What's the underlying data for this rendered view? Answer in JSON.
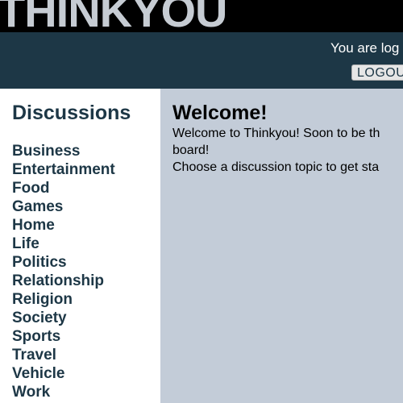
{
  "header": {
    "logo_text": "THINKYOU"
  },
  "account": {
    "status_text": "You are log",
    "logout_label": "LOGOU"
  },
  "sidebar": {
    "title": "Discussions",
    "topics": [
      "Business",
      "Entertainment",
      "Food",
      "Games",
      "Home",
      "Life",
      "Politics",
      "Relationship",
      "Religion",
      "Society",
      "Sports",
      "Travel",
      "Vehicle",
      "Work"
    ]
  },
  "main": {
    "title": "Welcome!",
    "lines": [
      "Welcome to Thinkyou! Soon to be th",
      "board!",
      "Choose a discussion topic to get sta"
    ]
  },
  "colors": {
    "banner_bg": "#000000",
    "logo": "#c6ccd3",
    "topbar_bg": "#1d3746",
    "sidebar_text": "#1d3746",
    "main_bg": "#c3ccd8"
  }
}
